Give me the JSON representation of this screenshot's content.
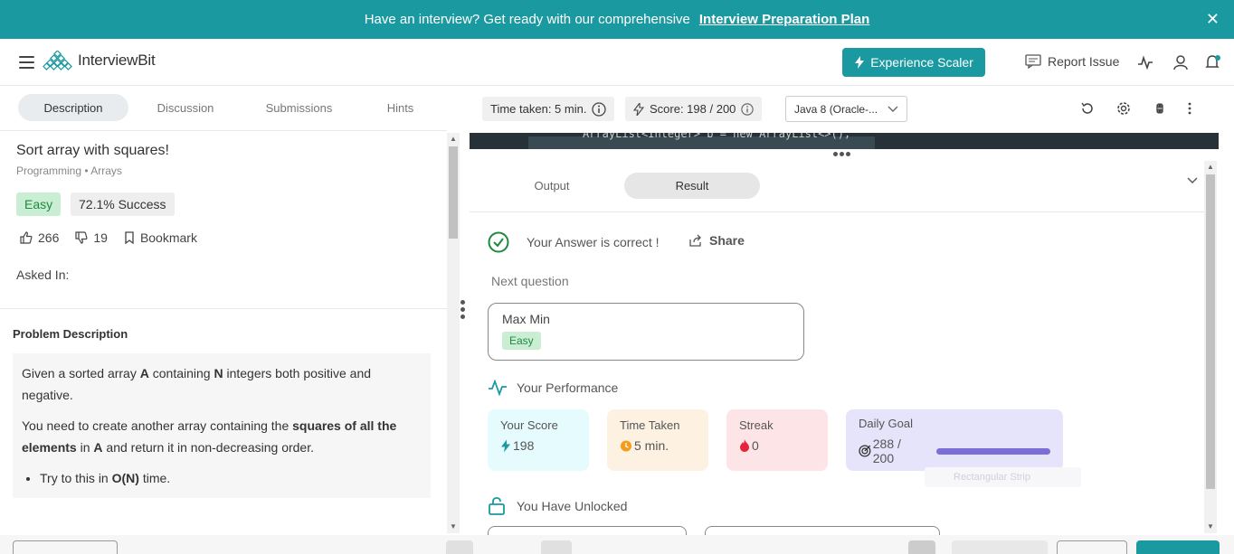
{
  "banner": {
    "text": "Have an interview? Get ready with our comprehensive",
    "link": "Interview Preparation Plan",
    "close": "✕"
  },
  "header": {
    "logo": "InterviewBit",
    "experience_btn": "Experience Scaler",
    "report_issue": "Report Issue"
  },
  "left": {
    "tabs": [
      "Description",
      "Discussion",
      "Submissions",
      "Hints"
    ],
    "problem_title": "Sort array with squares!",
    "breadcrumb": "Programming • Arrays",
    "difficulty": "Easy",
    "success_rate": "72.1% Success",
    "likes": "266",
    "dislikes": "19",
    "bookmark": "Bookmark",
    "asked_in": "Asked In:",
    "desc_heading": "Problem Description",
    "desc_p1_a": "Given a sorted array ",
    "desc_p1_b": "A",
    "desc_p1_c": " containing ",
    "desc_p1_d": "N",
    "desc_p1_e": " integers both positive and negative.",
    "desc_p2_a": "You need to create another array containing the ",
    "desc_p2_b": "squares of all the elements",
    "desc_p2_c": " in ",
    "desc_p2_d": "A",
    "desc_p2_e": " and return it in non-decreasing order.",
    "desc_li_a": "Try to this in ",
    "desc_li_b": "O(N)",
    "desc_li_c": " time."
  },
  "editor": {
    "time_taken": "Time taken: 5 min.",
    "score": "Score: 198  /  200",
    "language": "Java 8 (Oracle-...",
    "code_snippet": "ArrayList<Integer> b = new ArrayList<>();"
  },
  "result": {
    "tabs": [
      "Output",
      "Result"
    ],
    "correct_msg": "Your Answer is correct !",
    "share": "Share",
    "next_label": "Next question",
    "next_name": "Max Min",
    "next_level": "Easy",
    "perf_head": "Your Performance",
    "score_label": "Your Score",
    "score_val": "198",
    "time_label": "Time Taken",
    "time_val": "5 min.",
    "streak_label": "Streak",
    "streak_val": "0",
    "goal_label": "Daily Goal",
    "goal_val": "288 / 200",
    "ghost_text": "Rectangular Strip",
    "unlocked": "You Have Unlocked"
  },
  "colors": {
    "brand": "#1a9aa0",
    "easy_bg": "#c9eed3",
    "score_bg": "#e6fbfd",
    "time_bg": "#fdf1e2",
    "streak_bg": "#fde4e7",
    "goal_bg": "#e6e4fb"
  }
}
